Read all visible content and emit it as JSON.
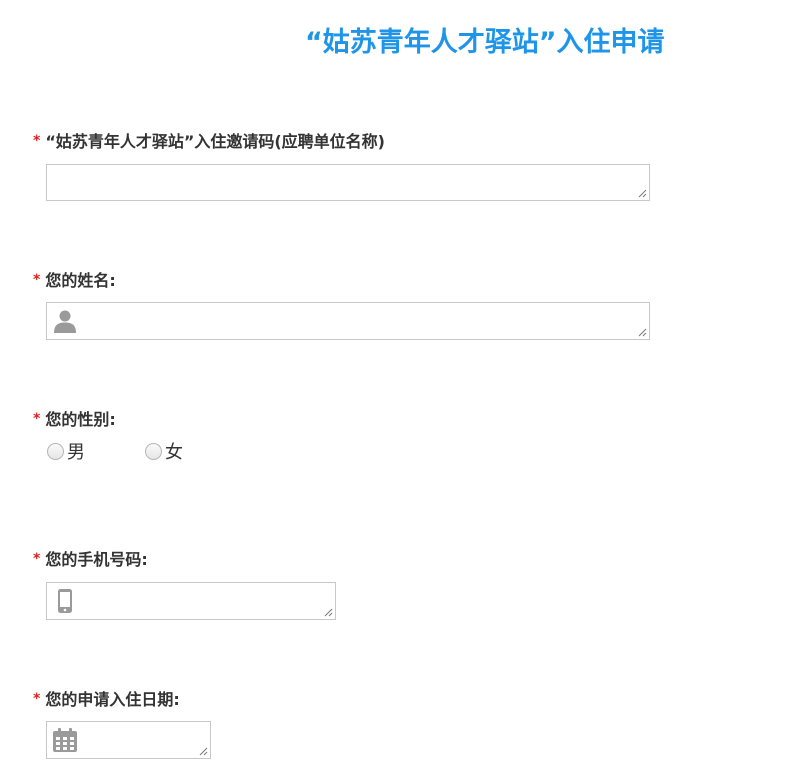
{
  "title": "“姑苏青年人才驿站”入住申请",
  "required_mark": "*",
  "fields": {
    "invite_code": {
      "label": "“姑苏青年人才驿站”入住邀请码(应聘单位名称)",
      "value": ""
    },
    "name": {
      "label": "您的姓名:",
      "value": "",
      "icon": "person-icon"
    },
    "gender": {
      "label": "您的性别:",
      "options": [
        "男",
        "女"
      ]
    },
    "phone": {
      "label": "您的手机号码:",
      "value": "",
      "icon": "mobile-phone-icon"
    },
    "checkin_date": {
      "label": "您的申请入住日期:",
      "value": "",
      "icon": "calendar-icon"
    }
  },
  "colors": {
    "title": "#1e95e8",
    "required": "#e02020",
    "label": "#333333",
    "border": "#c8c8c8",
    "icon": "#9a9a9a"
  }
}
